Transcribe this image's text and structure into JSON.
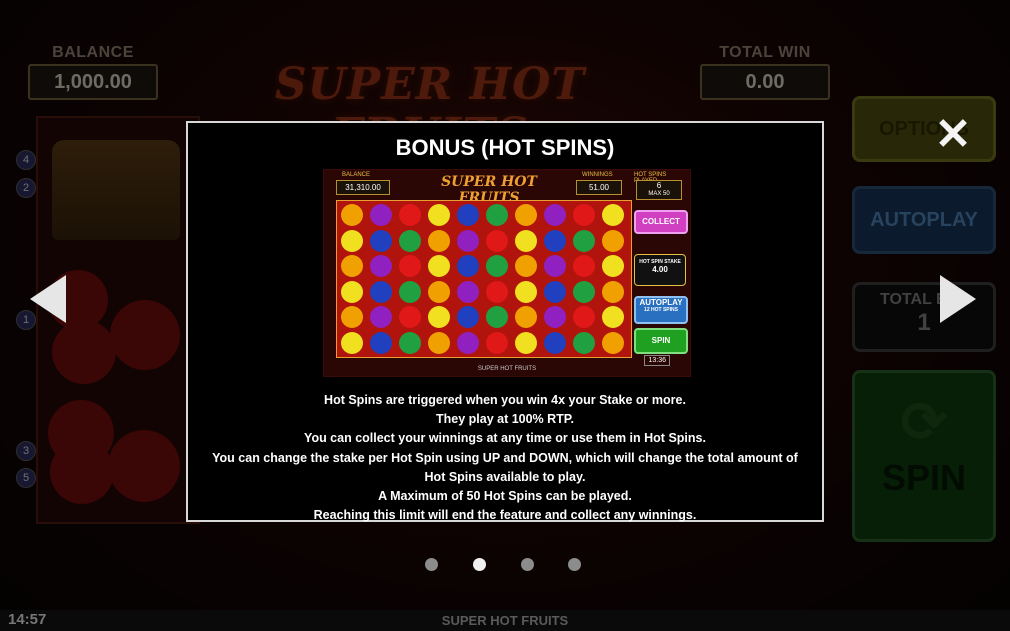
{
  "game": {
    "balance_label": "BALANCE",
    "balance_value": "1,000.00",
    "total_win_label": "TOTAL WIN",
    "total_win_value": "0.00",
    "logo_text": "SUPER HOT FRUITS"
  },
  "side_controls": {
    "options_label": "OPTIONS",
    "autoplay_label": "AUTOPLAY",
    "total_bet_label": "TOTAL BET",
    "total_bet_value": "1",
    "spin_label": "SPIN"
  },
  "paylines_left": [
    "4",
    "2",
    "1",
    "3",
    "5"
  ],
  "help_panel": {
    "title": "BONUS (HOT SPINS)",
    "description": [
      "Hot Spins are triggered when you win 4x your Stake or more.",
      "They play at 100% RTP.",
      "You can collect your winnings at any time or use them in Hot Spins.",
      "You can change the stake per Hot Spin using UP and DOWN, which will change the total amount of Hot Spins available to play.",
      "A Maximum of 50 Hot Spins can be played.",
      "Reaching this limit will end the feature and collect any winnings."
    ],
    "screenshot": {
      "balance_label": "BALANCE",
      "balance_value": "31,310.00",
      "winnings_label": "WINNINGS",
      "winnings_value": "51.00",
      "hot_spins_played_label": "HOT SPINS PLAYED",
      "hot_spins_played_value": "6",
      "hot_spins_max": "MAX 50",
      "logo_text": "SUPER HOT FRUITS",
      "collect_label": "COLLECT",
      "stake_label": "HOT SPIN STAKE",
      "stake_value": "4.00",
      "autoplay_label": "AUTOPLAY",
      "autoplay_sub": "12 HOT SPINS",
      "spin_label": "SPIN",
      "footer": "SUPER HOT FRUITS",
      "time": "13:36"
    }
  },
  "pager": {
    "count": 4,
    "active_index": 1
  },
  "status_bar": {
    "time": "14:57",
    "title": "SUPER HOT FRUITS"
  },
  "icons": {
    "close": "close-icon",
    "prev": "arrow-left-icon",
    "next": "arrow-right-icon"
  }
}
